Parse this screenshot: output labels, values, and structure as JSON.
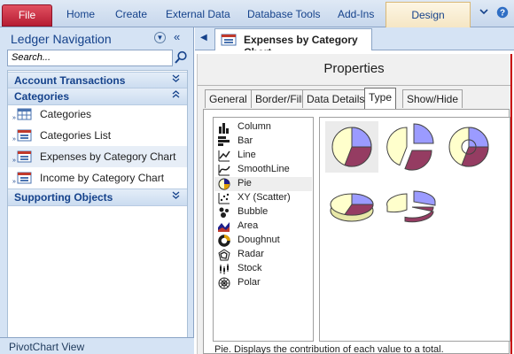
{
  "ribbon": {
    "file_label": "File",
    "tabs": [
      "Home",
      "Create",
      "External Data",
      "Database Tools",
      "Add-Ins"
    ],
    "contextual_tab": "Design",
    "controls": {
      "minimize": "♡",
      "help": "?"
    }
  },
  "nav": {
    "title": "Ledger Navigation",
    "search_placeholder": "Search...",
    "groups": [
      {
        "label": "Account Transactions",
        "expanded": false
      },
      {
        "label": "Categories",
        "expanded": true
      },
      {
        "label": "Supporting Objects",
        "expanded": false
      }
    ],
    "items": [
      {
        "label": "Categories",
        "icon": "table-icon"
      },
      {
        "label": "Categories List",
        "icon": "form-icon"
      },
      {
        "label": "Expenses by Category Chart",
        "icon": "form-icon",
        "selected": true
      },
      {
        "label": "Income by Category Chart",
        "icon": "form-icon"
      }
    ],
    "status": "PivotChart View"
  },
  "document": {
    "tab_label": "Expenses by Category Chart",
    "properties": {
      "title": "Properties",
      "tabs": [
        "General",
        "Border/Fill",
        "Data Details",
        "Type",
        "Show/Hide"
      ],
      "active_tab": "Type",
      "chart_types": [
        {
          "label": "Column",
          "icon": "column-chart-icon"
        },
        {
          "label": "Bar",
          "icon": "bar-chart-icon"
        },
        {
          "label": "Line",
          "icon": "line-chart-icon"
        },
        {
          "label": "SmoothLine",
          "icon": "smoothline-chart-icon"
        },
        {
          "label": "Pie",
          "icon": "pie-chart-icon",
          "selected": true
        },
        {
          "label": "XY (Scatter)",
          "icon": "scatter-chart-icon"
        },
        {
          "label": "Bubble",
          "icon": "bubble-chart-icon"
        },
        {
          "label": "Area",
          "icon": "area-chart-icon"
        },
        {
          "label": "Doughnut",
          "icon": "doughnut-chart-icon"
        },
        {
          "label": "Radar",
          "icon": "radar-chart-icon"
        },
        {
          "label": "Stock",
          "icon": "stock-chart-icon"
        },
        {
          "label": "Polar",
          "icon": "polar-chart-icon"
        }
      ],
      "subtypes": [
        "pie",
        "exploded-pie",
        "pie-of-pie",
        "3d-pie",
        "3d-exploded-pie"
      ],
      "description": "Pie. Displays the contribution of each value to a total."
    }
  },
  "colors": {
    "file_tab": "#c42b3c",
    "pie_blue": "#9b9bff",
    "pie_plum": "#953c62",
    "pie_cream": "#ffffcc",
    "selection": "#c80000"
  }
}
